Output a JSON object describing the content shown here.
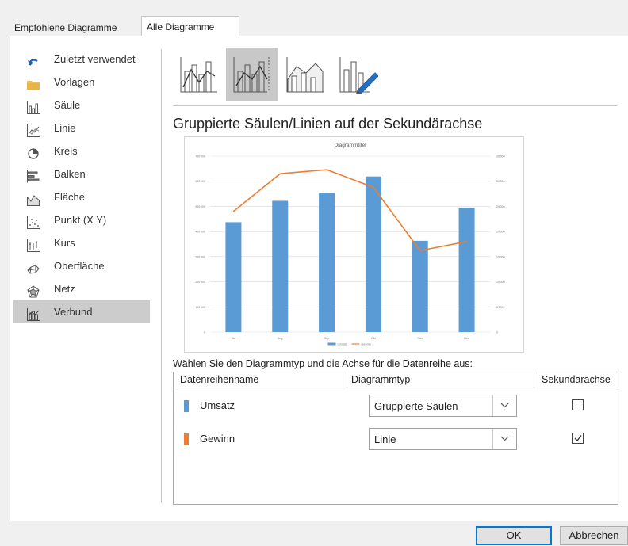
{
  "tabs": [
    {
      "label": "Empfohlene Diagramme",
      "active": false
    },
    {
      "label": "Alle Diagramme",
      "active": true
    }
  ],
  "sidebar": {
    "items": [
      {
        "label": "Zuletzt verwendet",
        "icon": "undo-arrow-icon"
      },
      {
        "label": "Vorlagen",
        "icon": "folder-icon"
      },
      {
        "label": "Säule",
        "icon": "column-chart-icon"
      },
      {
        "label": "Linie",
        "icon": "line-chart-icon"
      },
      {
        "label": "Kreis",
        "icon": "pie-chart-icon"
      },
      {
        "label": "Balken",
        "icon": "bar-chart-icon"
      },
      {
        "label": "Fläche",
        "icon": "area-chart-icon"
      },
      {
        "label": "Punkt (X Y)",
        "icon": "scatter-chart-icon"
      },
      {
        "label": "Kurs",
        "icon": "stock-chart-icon"
      },
      {
        "label": "Oberfläche",
        "icon": "surface-chart-icon"
      },
      {
        "label": "Netz",
        "icon": "radar-chart-icon"
      },
      {
        "label": "Verbund",
        "icon": "combo-chart-icon",
        "selected": true
      }
    ]
  },
  "subtypes": [
    {
      "name": "clustered-column-line-icon",
      "selected": false
    },
    {
      "name": "clustered-column-line-secondary-axis-icon",
      "selected": true
    },
    {
      "name": "stacked-area-clustered-column-icon",
      "selected": false
    },
    {
      "name": "custom-combination-icon",
      "selected": false
    }
  ],
  "main": {
    "chart_type_title": "Gruppierte Säulen/Linien auf der Sekundärachse"
  },
  "chart_data": {
    "type": "bar",
    "title": "Diagrammtitel",
    "categories": [
      "Jul",
      "Aug",
      "Sep",
      "Okt",
      "Nov",
      "Dez"
    ],
    "series": [
      {
        "name": "Umsatz",
        "type": "bar",
        "axis": "primary",
        "color": "#5b9bd5",
        "values": [
          437000,
          522000,
          554000,
          619000,
          363000,
          494000
        ]
      },
      {
        "name": "Gewinn",
        "type": "line",
        "axis": "secondary",
        "color": "#ed7d31",
        "values": [
          24000,
          31500,
          32300,
          28800,
          16200,
          18000
        ]
      }
    ],
    "y_ticks": [
      "0",
      "100'000",
      "200'000",
      "300'000",
      "400'000",
      "500'000",
      "600'000",
      "700'000"
    ],
    "y2_ticks": [
      "0",
      "5'000",
      "10'000",
      "15'000",
      "20'000",
      "25'000",
      "30'000",
      "35'000"
    ],
    "ylim": [
      0,
      700000
    ],
    "y2lim": [
      0,
      35000
    ],
    "grid": true,
    "legend": "bottom"
  },
  "series_table": {
    "instruction": "Wählen Sie den Diagrammtyp und die Achse für die Datenreihe aus:",
    "headers": {
      "name": "Datenreihenname",
      "type": "Diagrammtyp",
      "secondary": "Sekundärachse"
    },
    "rows": [
      {
        "name": "Umsatz",
        "color": "#5b9bd5",
        "chart_type": "Gruppierte Säulen",
        "secondary_axis": false
      },
      {
        "name": "Gewinn",
        "color": "#ed7d31",
        "chart_type": "Linie",
        "secondary_axis": true
      }
    ]
  },
  "buttons": {
    "ok": "OK",
    "cancel": "Abbrechen"
  }
}
